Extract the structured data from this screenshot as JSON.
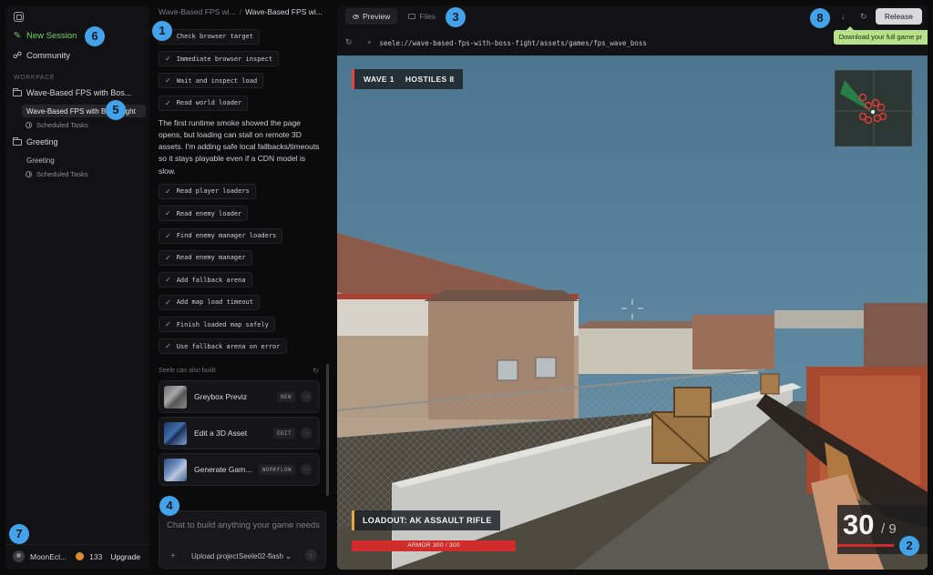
{
  "sidebar": {
    "new_session": "New Session",
    "community": "Community",
    "workspace_label": "WORKPACE",
    "projects": [
      {
        "name": "Wave-Based FPS with Bos...",
        "sessions": [
          "Wave-Based FPS with Boss Fight"
        ],
        "tasks": "Scheduled Tasks"
      },
      {
        "name": "Greeting",
        "sessions": [
          "Greeting"
        ],
        "tasks": "Scheduled Tasks"
      }
    ],
    "user": {
      "name": "MoonEcl...",
      "credits": "133",
      "upgrade": "Upgrade"
    }
  },
  "chat": {
    "breadcrumb": {
      "parent": "Wave-Based FPS wi...",
      "separator": "/",
      "current": "Wave-Based FPS wi..."
    },
    "steps_a": [
      "Check browser target",
      "Immediate browser inspect",
      "Wait and inspect load",
      "Read world loader"
    ],
    "narration": "The first runtime smoke showed the page opens, but loading can stall on remote 3D assets. I'm adding safe local fallbacks/timeouts so it stays playable even if a CDN model is slow.",
    "steps_b": [
      "Read player loaders",
      "Read enemy loader",
      "Find enemy manager loaders",
      "Read enemy manager",
      "Add fallback arena",
      "Add map load timeout",
      "Finish loaded map safely",
      "Use fallback arena on error"
    ],
    "also_build_label": "Seele can also build",
    "cards": [
      {
        "title": "Greybox Previz",
        "tag": "NEW"
      },
      {
        "title": "Edit a 3D Asset",
        "tag": "EDIT"
      },
      {
        "title": "Generate Gam...",
        "tag": "WORKFLOW"
      }
    ],
    "composer": {
      "placeholder": "Chat to build anything your game needs",
      "upload": "Upload project",
      "model": "Seele02-flash"
    }
  },
  "preview": {
    "tabs": [
      "Preview",
      "Files"
    ],
    "release": "Release",
    "tooltip": "Download your full game pr",
    "url": "seele://wave-based-fps-with-boss-fight/assets/games/fps_wave_boss",
    "hud": {
      "wave": "WAVE 1",
      "hostiles": "HOSTILES 8",
      "loadout": "LOADOUT: AK ASSAULT RIFLE",
      "armor": "ARMOR 300 / 300",
      "ammo": "30",
      "ammo_reserve": "/ 9"
    }
  },
  "markers": [
    "1",
    "2",
    "3",
    "4",
    "5",
    "6",
    "7",
    "8"
  ],
  "colors": {
    "accent_green": "#6fd26a",
    "marker_blue": "#42a3ea",
    "hud_red": "#d12c2c",
    "release_bg": "#d9d9dc",
    "tooltip_green": "#b6e08a"
  }
}
